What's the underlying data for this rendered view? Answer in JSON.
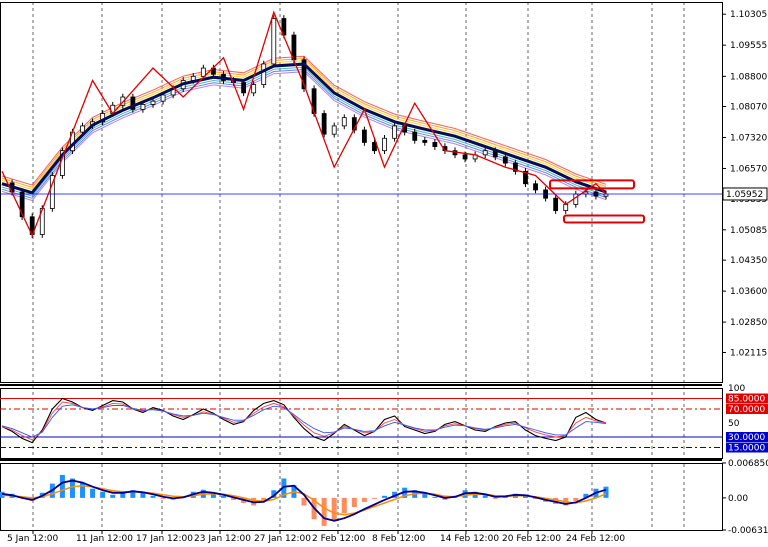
{
  "chart_data": [
    {
      "type": "candlestick",
      "panel": "price",
      "title": "",
      "ylim": [
        1.014,
        1.106
      ],
      "y_ticks": [
        "1.10305",
        "1.09555",
        "1.08800",
        "1.08070",
        "1.07320",
        "1.06570",
        "1.05835",
        "1.05085",
        "1.04350",
        "1.03600",
        "1.02850",
        "1.02115"
      ],
      "x_ticks": [
        "5 Jan 12:00",
        "11 Jan 12:00",
        "17 Jan 12:00",
        "23 Jan 12:00",
        "27 Jan 12:00",
        "2 Feb 12:00",
        "8 Feb 12:00",
        "14 Feb 12:00",
        "20 Feb 12:00",
        "24 Feb 12:00"
      ],
      "current_price": "1.05952",
      "series": [
        {
          "name": "",
          "kind": "close",
          "x": [
            0,
            2,
            4,
            6,
            8,
            10,
            12,
            14,
            16,
            18,
            20,
            22,
            24,
            26,
            28,
            30,
            32,
            34,
            36,
            38,
            40,
            42,
            44,
            46,
            48,
            50,
            52,
            54,
            56,
            58,
            60,
            62,
            64,
            66,
            68,
            70,
            72,
            74,
            76,
            78,
            80,
            82,
            84,
            86,
            88,
            90,
            92,
            94,
            96,
            98,
            100,
            102,
            104,
            106,
            108,
            110,
            112,
            114,
            116,
            118,
            120
          ],
          "values": [
            1.0622,
            1.06,
            1.054,
            1.0497,
            1.056,
            1.064,
            1.07,
            1.0745,
            1.076,
            1.077,
            1.079,
            1.081,
            1.083,
            1.08,
            1.0812,
            1.082,
            1.0835,
            1.085,
            1.087,
            1.088,
            1.09,
            1.0885,
            1.087,
            1.0865,
            1.084,
            1.086,
            1.091,
            1.102,
            1.098,
            1.092,
            1.085,
            1.079,
            1.074,
            1.076,
            1.078,
            1.075,
            1.072,
            1.07,
            1.073,
            1.076,
            1.0745,
            1.0725,
            1.072,
            1.071,
            1.07,
            1.069,
            1.068,
            1.069,
            1.07,
            1.0685,
            1.067,
            1.065,
            1.062,
            1.0605,
            1.0585,
            1.0555,
            1.057,
            1.0595,
            1.06,
            1.059,
            1.0595
          ]
        },
        {
          "name": "",
          "kind": "moving-average",
          "x": [
            0,
            6,
            12,
            18,
            24,
            30,
            36,
            42,
            48,
            54,
            60,
            66,
            72,
            78,
            84,
            90,
            96,
            102,
            108,
            114,
            120
          ],
          "values": [
            1.062,
            1.0598,
            1.069,
            1.0762,
            1.0798,
            1.0828,
            1.0862,
            1.0878,
            1.087,
            1.0905,
            1.091,
            1.084,
            1.08,
            1.077,
            1.0752,
            1.0735,
            1.071,
            1.0685,
            1.066,
            1.0625,
            1.06
          ]
        }
      ],
      "zigzag": {
        "x": [
          0,
          6,
          18,
          22,
          30,
          36,
          44,
          48,
          54,
          60,
          66,
          72,
          76,
          82,
          88,
          94,
          100,
          106,
          112,
          118,
          120
        ],
        "values": [
          1.065,
          1.0495,
          1.087,
          1.079,
          1.09,
          1.083,
          1.0925,
          1.08,
          1.1035,
          1.086,
          1.066,
          1.08,
          1.066,
          1.0815,
          1.07,
          1.069,
          1.066,
          1.064,
          1.057,
          1.062,
          1.0595
        ]
      },
      "annotations": [
        "rectangle near 1.0625",
        "rectangle near 1.0540"
      ]
    },
    {
      "type": "line",
      "panel": "oscillator-1",
      "ylim": [
        0,
        100
      ],
      "y_ticks": [
        "100",
        "85.0000",
        "70.0000",
        "50",
        "30.0000",
        "15.0000"
      ],
      "levels": [
        85,
        70,
        30,
        15
      ],
      "series": [
        {
          "name": "",
          "values": [
            45,
            38,
            28,
            22,
            40,
            70,
            85,
            80,
            72,
            68,
            75,
            82,
            80,
            70,
            65,
            72,
            68,
            60,
            55,
            62,
            70,
            64,
            55,
            48,
            52,
            68,
            78,
            82,
            76,
            58,
            42,
            30,
            25,
            35,
            48,
            40,
            32,
            38,
            55,
            60,
            45,
            40,
            35,
            38,
            48,
            52,
            46,
            40,
            38,
            45,
            50,
            52,
            40,
            32,
            28,
            25,
            30,
            58,
            65,
            55,
            50
          ]
        },
        {
          "name": "",
          "values": [
            45,
            40,
            32,
            26,
            38,
            64,
            80,
            78,
            72,
            70,
            73,
            78,
            77,
            70,
            67,
            70,
            67,
            62,
            58,
            61,
            66,
            63,
            57,
            51,
            53,
            64,
            73,
            78,
            73,
            60,
            47,
            36,
            31,
            36,
            45,
            41,
            36,
            38,
            50,
            55,
            47,
            42,
            38,
            39,
            46,
            49,
            46,
            42,
            40,
            44,
            48,
            50,
            43,
            37,
            33,
            30,
            32,
            50,
            58,
            53,
            50
          ]
        },
        {
          "name": "",
          "values": [
            46,
            42,
            36,
            30,
            37,
            58,
            74,
            76,
            72,
            70,
            72,
            75,
            75,
            71,
            68,
            69,
            67,
            63,
            60,
            61,
            64,
            62,
            58,
            54,
            54,
            61,
            69,
            74,
            72,
            62,
            51,
            42,
            36,
            37,
            43,
            41,
            38,
            39,
            46,
            51,
            47,
            43,
            40,
            40,
            44,
            47,
            46,
            43,
            41,
            43,
            46,
            48,
            44,
            40,
            36,
            33,
            33,
            43,
            52,
            51,
            49
          ]
        }
      ]
    },
    {
      "type": "bar",
      "panel": "oscillator-2",
      "ylim": [
        -0.0063128,
        0.0068503
      ],
      "y_ticks": [
        "0.0068503",
        "0.00",
        "-0.0063128"
      ],
      "series": [
        {
          "name": "",
          "kind": "histogram",
          "values": [
            0.0012,
            0.0008,
            0.0002,
            -0.0006,
            0.001,
            0.0028,
            0.0045,
            0.0038,
            0.003,
            0.0018,
            0.0012,
            0.0006,
            0.001,
            0.0015,
            0.001,
            0.0004,
            -0.0002,
            -0.0004,
            0.0003,
            0.0012,
            0.0016,
            0.001,
            0.0004,
            -0.0004,
            -0.001,
            -0.0015,
            -0.0008,
            0.0015,
            0.0038,
            0.0025,
            -0.0015,
            -0.0042,
            -0.0055,
            -0.0045,
            -0.003,
            -0.0018,
            -0.0008,
            -0.0002,
            0.0004,
            0.0012,
            0.002,
            0.0015,
            0.0008,
            0.0002,
            -0.0004,
            0.0004,
            0.0015,
            0.0012,
            0.0005,
            -0.0002,
            0.0004,
            0.0008,
            0.0004,
            -0.0002,
            -0.0008,
            -0.0012,
            -0.0015,
            -0.0006,
            0.0008,
            0.0018,
            0.0022
          ]
        },
        {
          "name": "",
          "kind": "signal",
          "values": [
            0.0005,
            0.0004,
            0.0002,
            0.0,
            0.0002,
            0.0008,
            0.0015,
            0.0022,
            0.0024,
            0.0022,
            0.0018,
            0.0014,
            0.0012,
            0.0012,
            0.0011,
            0.0009,
            0.0006,
            0.0003,
            0.0002,
            0.0004,
            0.0007,
            0.0008,
            0.0007,
            0.0004,
            0.0,
            -0.0005,
            -0.0007,
            -0.0003,
            0.0006,
            0.0012,
            0.0008,
            -0.0005,
            -0.002,
            -0.003,
            -0.0033,
            -0.003,
            -0.0024,
            -0.0017,
            -0.001,
            -0.0003,
            0.0004,
            0.0008,
            0.0009,
            0.0007,
            0.0003,
            0.0002,
            0.0005,
            0.0007,
            0.0007,
            0.0004,
            0.0003,
            0.0004,
            0.0004,
            0.0002,
            -0.0001,
            -0.0004,
            -0.0008,
            -0.001,
            -0.0006,
            0.0,
            0.0008
          ]
        },
        {
          "name": "",
          "kind": "main",
          "values": [
            0.0008,
            0.0005,
            0.0,
            -0.0004,
            0.0004,
            0.0015,
            0.003,
            0.0034,
            0.003,
            0.0022,
            0.0015,
            0.001,
            0.001,
            0.0013,
            0.0011,
            0.0007,
            0.0002,
            -0.0001,
            0.0001,
            0.0007,
            0.0012,
            0.001,
            0.0006,
            0.0001,
            -0.0004,
            -0.0009,
            -0.0008,
            0.0004,
            0.0022,
            0.0024,
            0.0006,
            -0.002,
            -0.004,
            -0.0045,
            -0.004,
            -0.0032,
            -0.0022,
            -0.0013,
            -0.0004,
            0.0004,
            0.0012,
            0.0013,
            0.001,
            0.0005,
            0.0,
            0.0002,
            0.0009,
            0.001,
            0.0007,
            0.0002,
            0.0003,
            0.0006,
            0.0005,
            0.0001,
            -0.0004,
            -0.0008,
            -0.0012,
            -0.0009,
            0.0,
            0.001,
            0.0016
          ]
        }
      ]
    }
  ],
  "colors": {
    "price_line": "#0000ff",
    "candle_up": "#000000",
    "zigzag": "#e00000",
    "ma_thick": "#0a0a5a",
    "level_high": "#e00000",
    "level_low": "#0000cc",
    "hist_pos": "#1e90ff",
    "hist_neg": "#ff8c5a",
    "signal": "#ff8c00",
    "main": "#00008b",
    "grid": "#000000"
  }
}
